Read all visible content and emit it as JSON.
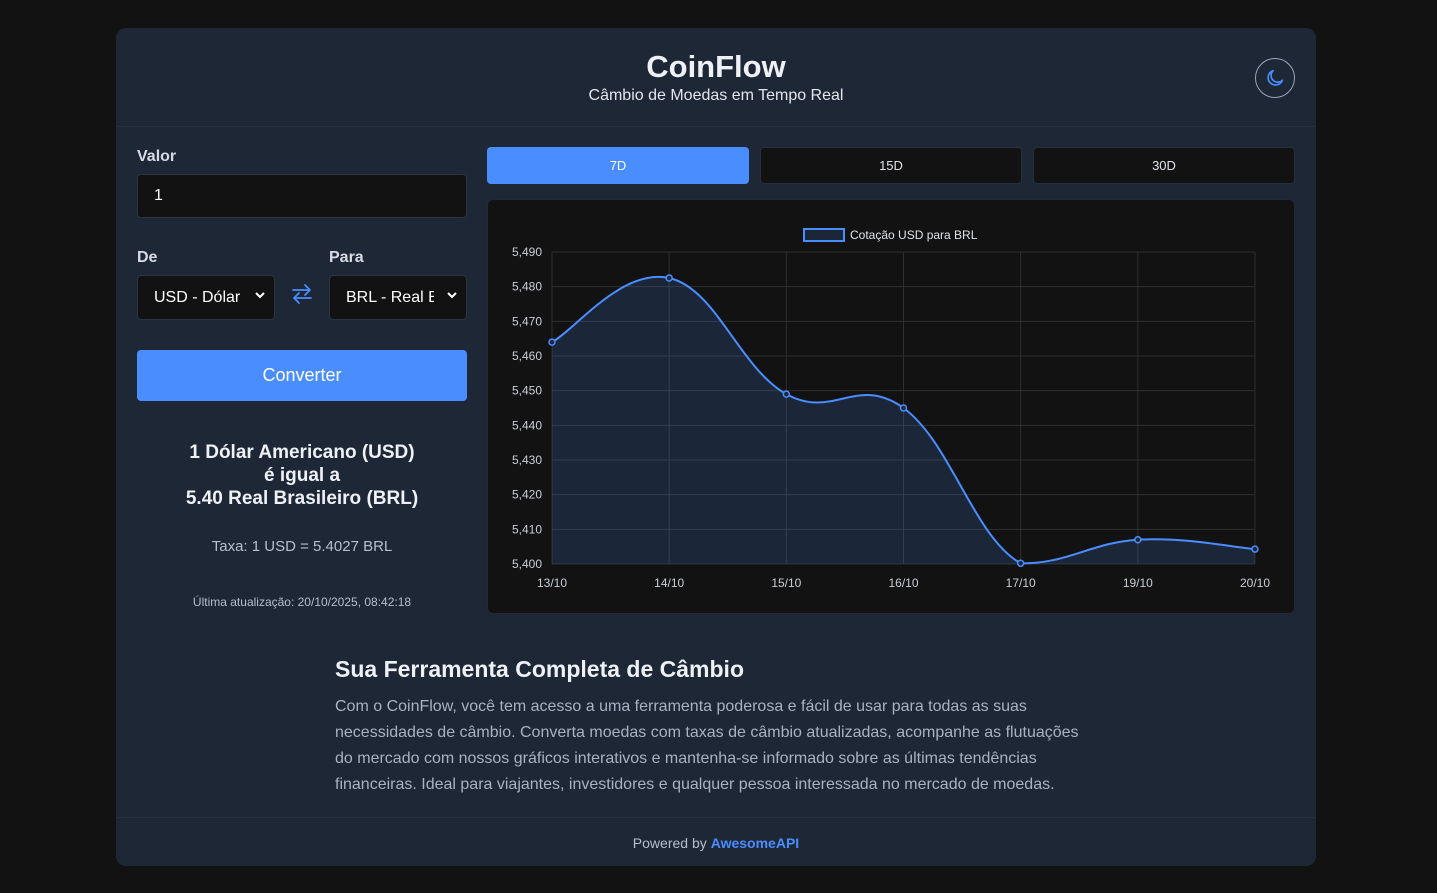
{
  "header": {
    "title": "CoinFlow",
    "subtitle": "Câmbio de Moedas em Tempo Real",
    "theme_icon": "moon-icon"
  },
  "converter": {
    "amount_label": "Valor",
    "amount_value": "1",
    "from_label": "De",
    "from_value": "USD - Dólar Americano",
    "to_label": "Para",
    "to_value": "BRL - Real Brasileiro",
    "swap_icon": "swap-arrows-icon",
    "convert_label": "Converter"
  },
  "result": {
    "line1": "1 Dólar Americano (USD)",
    "line2": "é igual a",
    "line3": "5.40 Real Brasileiro (BRL)",
    "rate": "Taxa: 1 USD = 5.4027 BRL",
    "updated": "Última atualização: 20/10/2025, 08:42:18"
  },
  "periods": [
    {
      "label": "7D",
      "active": true
    },
    {
      "label": "15D",
      "active": false
    },
    {
      "label": "30D",
      "active": false
    }
  ],
  "chart_data": {
    "type": "line",
    "series": [
      {
        "name": "Cotação USD para BRL",
        "values": [
          5.464,
          5.4825,
          5.449,
          5.445,
          5.4002,
          5.407,
          5.4043
        ]
      }
    ],
    "x": [
      "13/10",
      "14/10",
      "15/10",
      "16/10",
      "17/10",
      "19/10",
      "20/10"
    ],
    "yticks": [
      "5,400",
      "5,410",
      "5,420",
      "5,430",
      "5,440",
      "5,450",
      "5,460",
      "5,470",
      "5,480",
      "5,490"
    ],
    "ylim": [
      5.4,
      5.49
    ],
    "grid": true,
    "legend": "top",
    "color": "#4a8dff",
    "fill": true
  },
  "info": {
    "title": "Sua Ferramenta Completa de Câmbio",
    "text": "Com o CoinFlow, você tem acesso a uma ferramenta poderosa e fácil de usar para todas as suas necessidades de câmbio. Converta moedas com taxas de câmbio atualizadas, acompanhe as flutuações do mercado com nossos gráficos interativos e mantenha-se informado sobre as últimas tendências financeiras. Ideal para viajantes, investidores e qualquer pessoa interessada no mercado de moedas."
  },
  "footer": {
    "prefix": "Powered by",
    "link": "AwesomeAPI"
  },
  "colors": {
    "accent": "#4a8dff",
    "card": "#1d2736",
    "page": "#121212"
  }
}
